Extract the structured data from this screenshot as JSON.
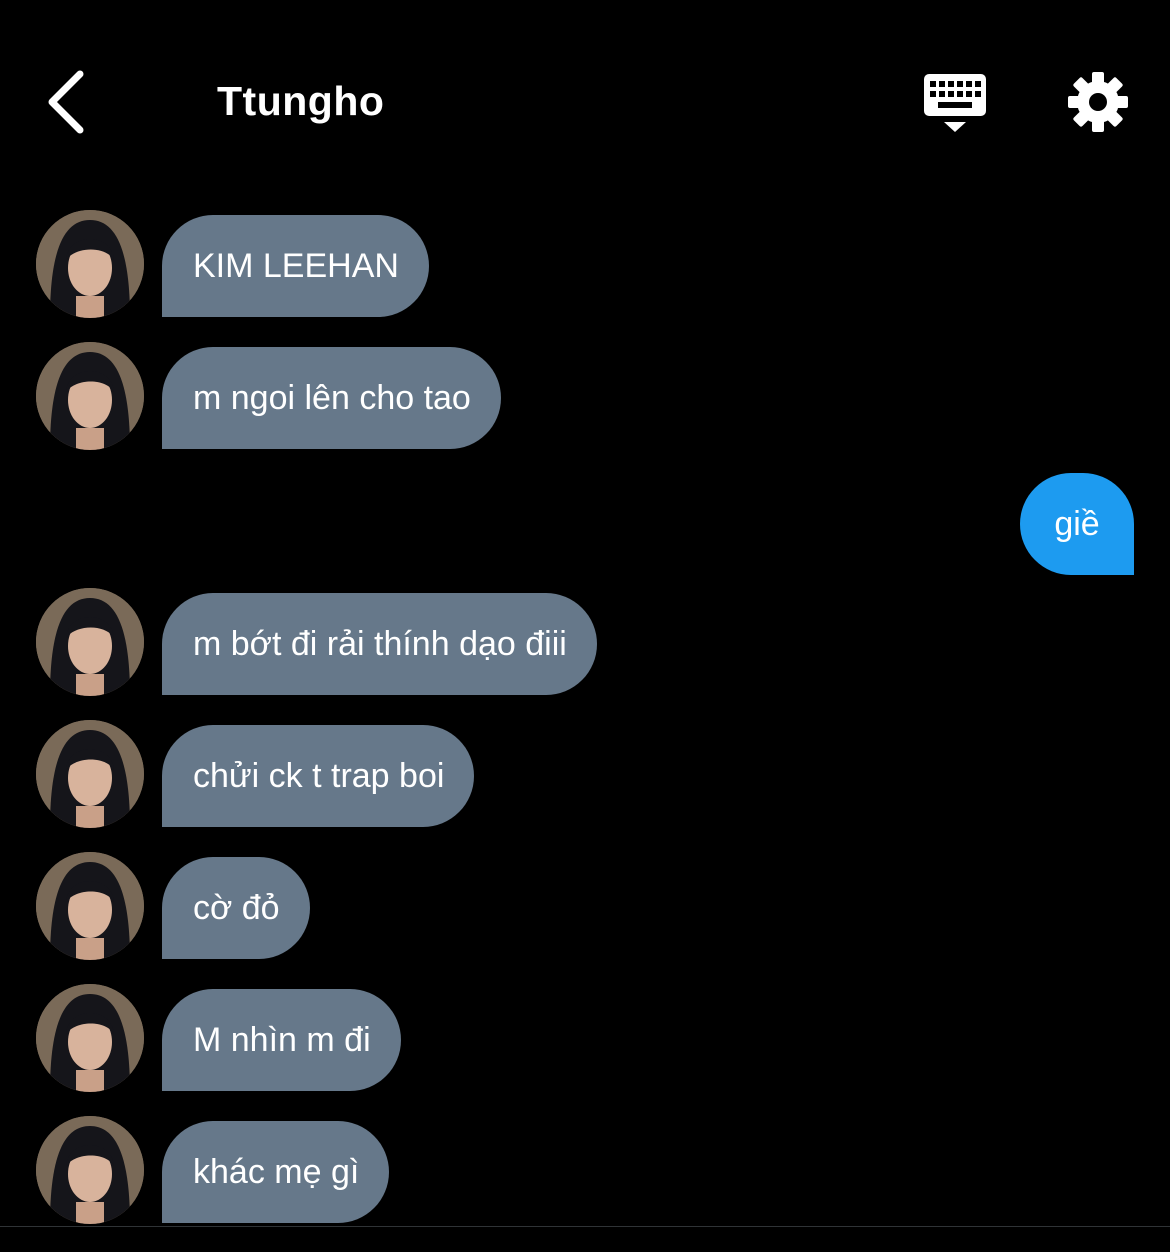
{
  "header": {
    "title": "Ttungho",
    "back_icon": "chevron-left-icon",
    "keyboard_icon": "keyboard-icon",
    "settings_icon": "gear-icon"
  },
  "colors": {
    "background": "#000000",
    "incoming_bubble": "#66788a",
    "outgoing_bubble": "#1d9bf0",
    "text": "#ffffff"
  },
  "messages": [
    {
      "direction": "incoming",
      "text": "KIM LEEHAN"
    },
    {
      "direction": "incoming",
      "text": "m ngoi lên cho tao"
    },
    {
      "direction": "outgoing",
      "text": "giề"
    },
    {
      "direction": "incoming",
      "text": "m bớt đi rải thính dạo điii"
    },
    {
      "direction": "incoming",
      "text": "chửi ck t trap boi"
    },
    {
      "direction": "incoming",
      "text": "cờ đỏ"
    },
    {
      "direction": "incoming",
      "text": "M nhìn m đi"
    },
    {
      "direction": "incoming",
      "text": "khác mẹ gì"
    }
  ]
}
